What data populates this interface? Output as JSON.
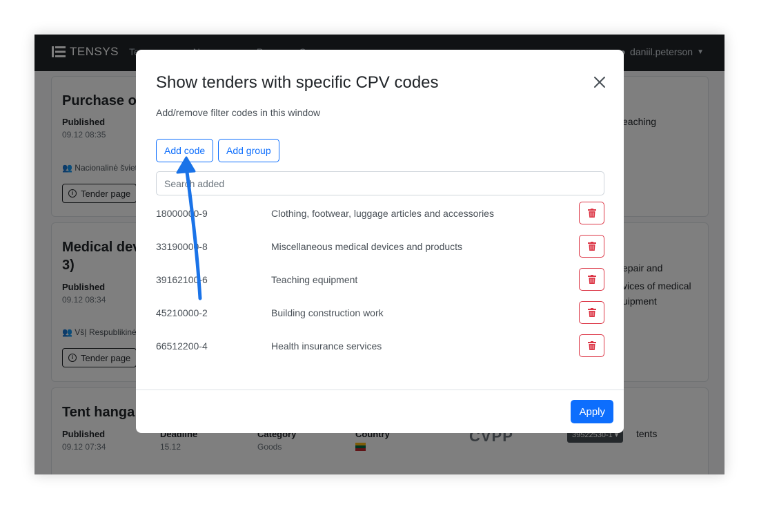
{
  "navbar": {
    "brand": "TENSYS",
    "links": [
      "Te",
      "N",
      "P",
      "C"
    ],
    "user": "daniil.peterson"
  },
  "background": {
    "cards": [
      {
        "title": "Purchase of",
        "published_label": "Published",
        "published_value": "09.12 08:35",
        "buyer": "Nacionalinė švieti",
        "button": "Tender page",
        "side_lines": [
          "eaching"
        ]
      },
      {
        "title_line1": "Medical dev",
        "title_line2": "3)",
        "published_label": "Published",
        "published_value": "09.12 08:34",
        "buyer": "VšĮ Respublikinė",
        "button": "Tender page",
        "side_lines": [
          "epair and",
          "vices of medical",
          "uipment"
        ]
      },
      {
        "title": "Tent hanga",
        "published_label": "Published",
        "published_value": "09.12 07:34",
        "deadline_label": "Deadline",
        "deadline_value": "15.12",
        "category_label": "Category",
        "category_value": "Goods",
        "country_label": "Country",
        "logo": "CVPP",
        "cpv_pill": "39522530-1",
        "side_lines": [
          "tents"
        ]
      }
    ]
  },
  "modal": {
    "title": "Show tenders with specific CPV codes",
    "subtitle": "Add/remove filter codes in this window",
    "add_code": "Add code",
    "add_group": "Add group",
    "search_placeholder": "Search added",
    "codes": [
      {
        "code": "18000000-9",
        "description": "Clothing, footwear, luggage articles and accessories"
      },
      {
        "code": "33190000-8",
        "description": "Miscellaneous medical devices and products"
      },
      {
        "code": "39162100-6",
        "description": "Teaching equipment"
      },
      {
        "code": "45210000-2",
        "description": "Building construction work"
      },
      {
        "code": "66512200-4",
        "description": "Health insurance services"
      }
    ],
    "apply": "Apply"
  },
  "colors": {
    "primary": "#0d6efd",
    "danger": "#dc3545",
    "navbar": "#212529",
    "arrow": "#1a73e8"
  }
}
